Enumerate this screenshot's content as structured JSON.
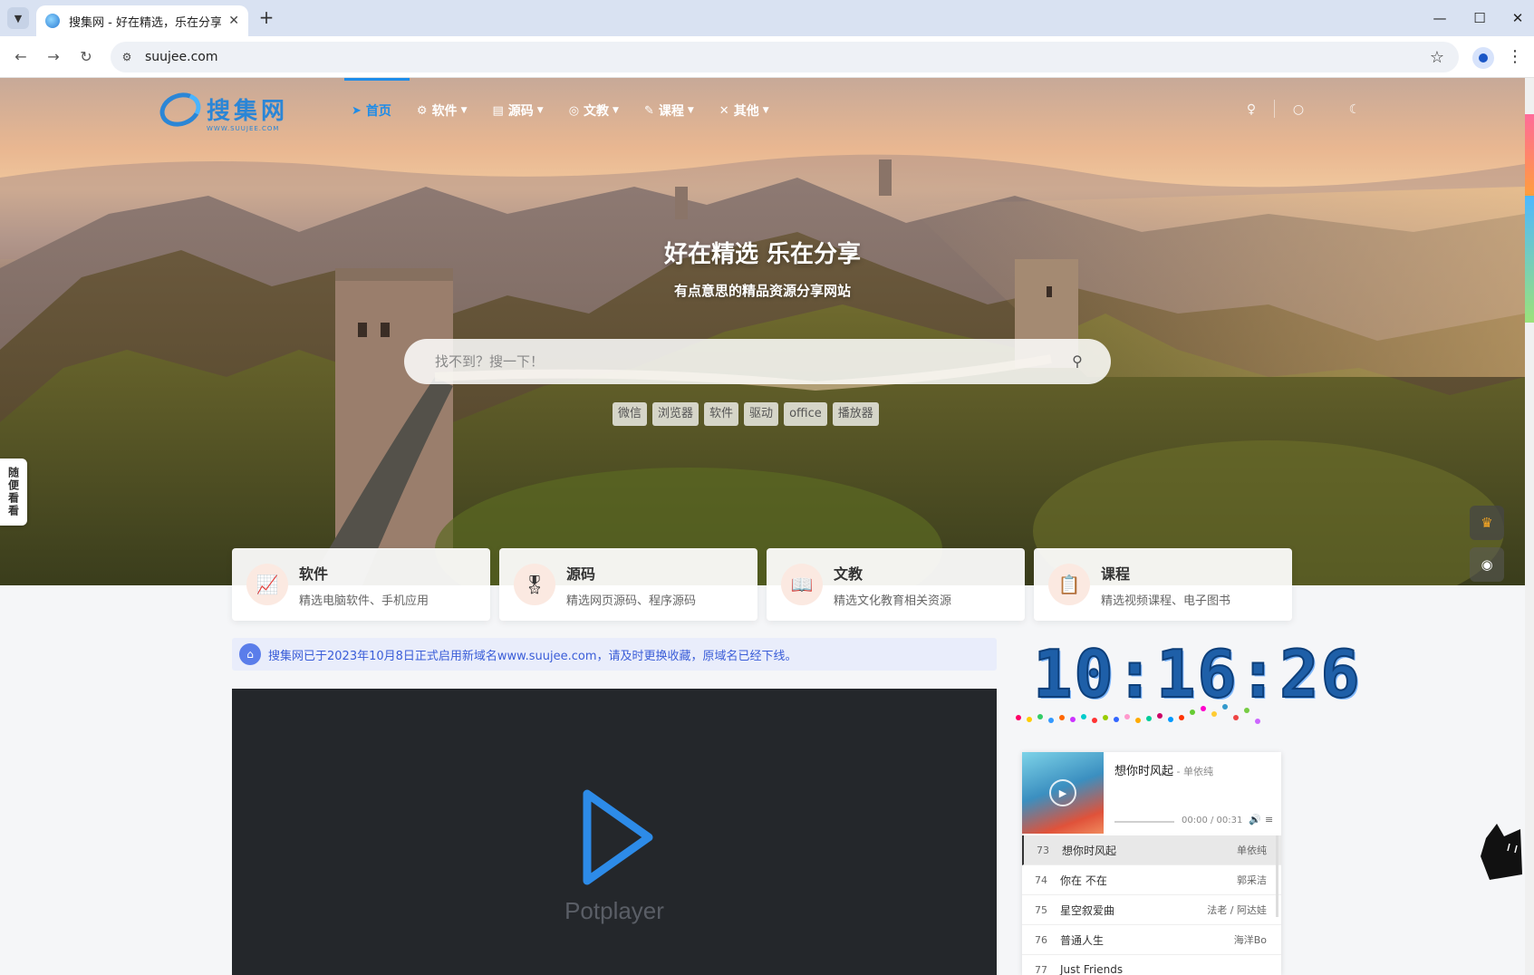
{
  "browser": {
    "tab_title": "搜集网 - 好在精选，乐在分享!",
    "tab_close": "✕",
    "new_tab": "+",
    "url": "suujee.com",
    "win_minimize": "—",
    "win_maximize": "☐",
    "win_close": "✕"
  },
  "site": {
    "logo_text": "搜集网",
    "logo_sub": "WWW.SUUJEE.COM",
    "nav": [
      {
        "label": "首页",
        "icon": "paper-plane-icon",
        "active": true
      },
      {
        "label": "软件",
        "icon": "gears-icon"
      },
      {
        "label": "源码",
        "icon": "file-code-icon"
      },
      {
        "label": "文教",
        "icon": "compass-icon"
      },
      {
        "label": "课程",
        "icon": "pen-icon"
      },
      {
        "label": "其他",
        "icon": "tools-icon"
      }
    ]
  },
  "hero": {
    "title": "好在精选 乐在分享",
    "subtitle": "有点意思的精品资源分享网站",
    "search_placeholder": "找不到？搜一下！",
    "tags": [
      "微信",
      "浏览器",
      "软件",
      "驱动",
      "office",
      "播放器"
    ]
  },
  "left_float": {
    "label": "随便看看"
  },
  "categories": [
    {
      "title": "软件",
      "desc": "精选电脑软件、手机应用",
      "icon": "chart-icon"
    },
    {
      "title": "源码",
      "desc": "精选网页源码、程序源码",
      "icon": "badge-icon"
    },
    {
      "title": "文教",
      "desc": "精选文化教育相关资源",
      "icon": "book-icon"
    },
    {
      "title": "课程",
      "desc": "精选视频课程、电子图书",
      "icon": "clipboard-icon"
    }
  ],
  "notice": {
    "text": "搜集网已于2023年10月8日正式启用新域名www.suujee.com，请及时更换收藏，原域名已经下线。"
  },
  "video": {
    "brand": "Potplayer"
  },
  "clock": {
    "time": "10:16:26"
  },
  "player": {
    "song": "想你时风起",
    "artist": " - 单依纯",
    "time": "00:00 / 00:31",
    "playlist": [
      {
        "idx": "73",
        "name": "想你时风起",
        "artist": "单依纯",
        "current": true
      },
      {
        "idx": "74",
        "name": "你在 不在",
        "artist": "郭采洁"
      },
      {
        "idx": "75",
        "name": "星空叙爱曲",
        "artist": "法老 / 阿达娃"
      },
      {
        "idx": "76",
        "name": "普通人生",
        "artist": "海洋Bo"
      },
      {
        "idx": "77",
        "name": "Just Friends",
        "artist": ""
      }
    ]
  }
}
